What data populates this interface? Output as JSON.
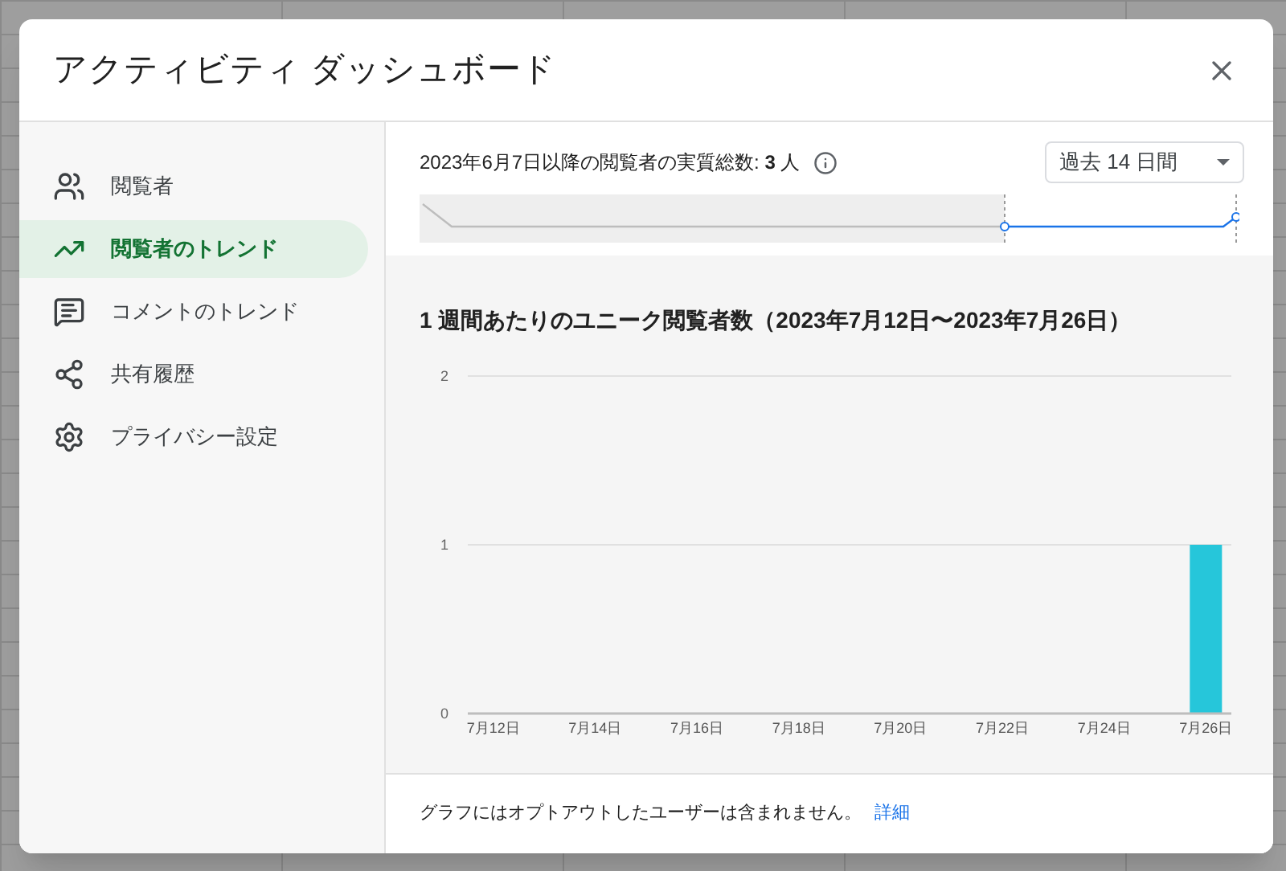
{
  "dialog": {
    "title": "アクティビティ ダッシュボード"
  },
  "sidebar": {
    "items": [
      {
        "label": "閲覧者",
        "selected": false
      },
      {
        "label": "閲覧者のトレンド",
        "selected": true
      },
      {
        "label": "コメントのトレンド",
        "selected": false
      },
      {
        "label": "共有履歴",
        "selected": false
      },
      {
        "label": "プライバシー設定",
        "selected": false
      }
    ]
  },
  "summary": {
    "text": "2023年6月7日以降の閲覧者の実質総数: **3** 人",
    "range_select": {
      "value": "過去 14 日間"
    }
  },
  "chart": {
    "title": "1 週間あたりのユニーク閲覧者数（2023年7月12日〜2023年7月26日）",
    "chart_data": {
      "type": "bar",
      "categories": [
        "7月12日",
        null,
        "7月14日",
        null,
        "7月16日",
        null,
        "7月18日",
        null,
        "7月20日",
        null,
        "7月22日",
        null,
        "7月24日",
        null,
        "7月26日"
      ],
      "series": [
        {
          "color": "#26c6da",
          "values": [
            0,
            0,
            0,
            0,
            0,
            0,
            0,
            0,
            0,
            0,
            0,
            0,
            0,
            0,
            1
          ]
        }
      ],
      "ylim": [
        0,
        2
      ],
      "yticks": [
        0,
        1,
        2
      ]
    }
  },
  "footer": {
    "note": "グラフにはオプトアウトしたユーザーは含まれません。",
    "link": "詳細"
  }
}
